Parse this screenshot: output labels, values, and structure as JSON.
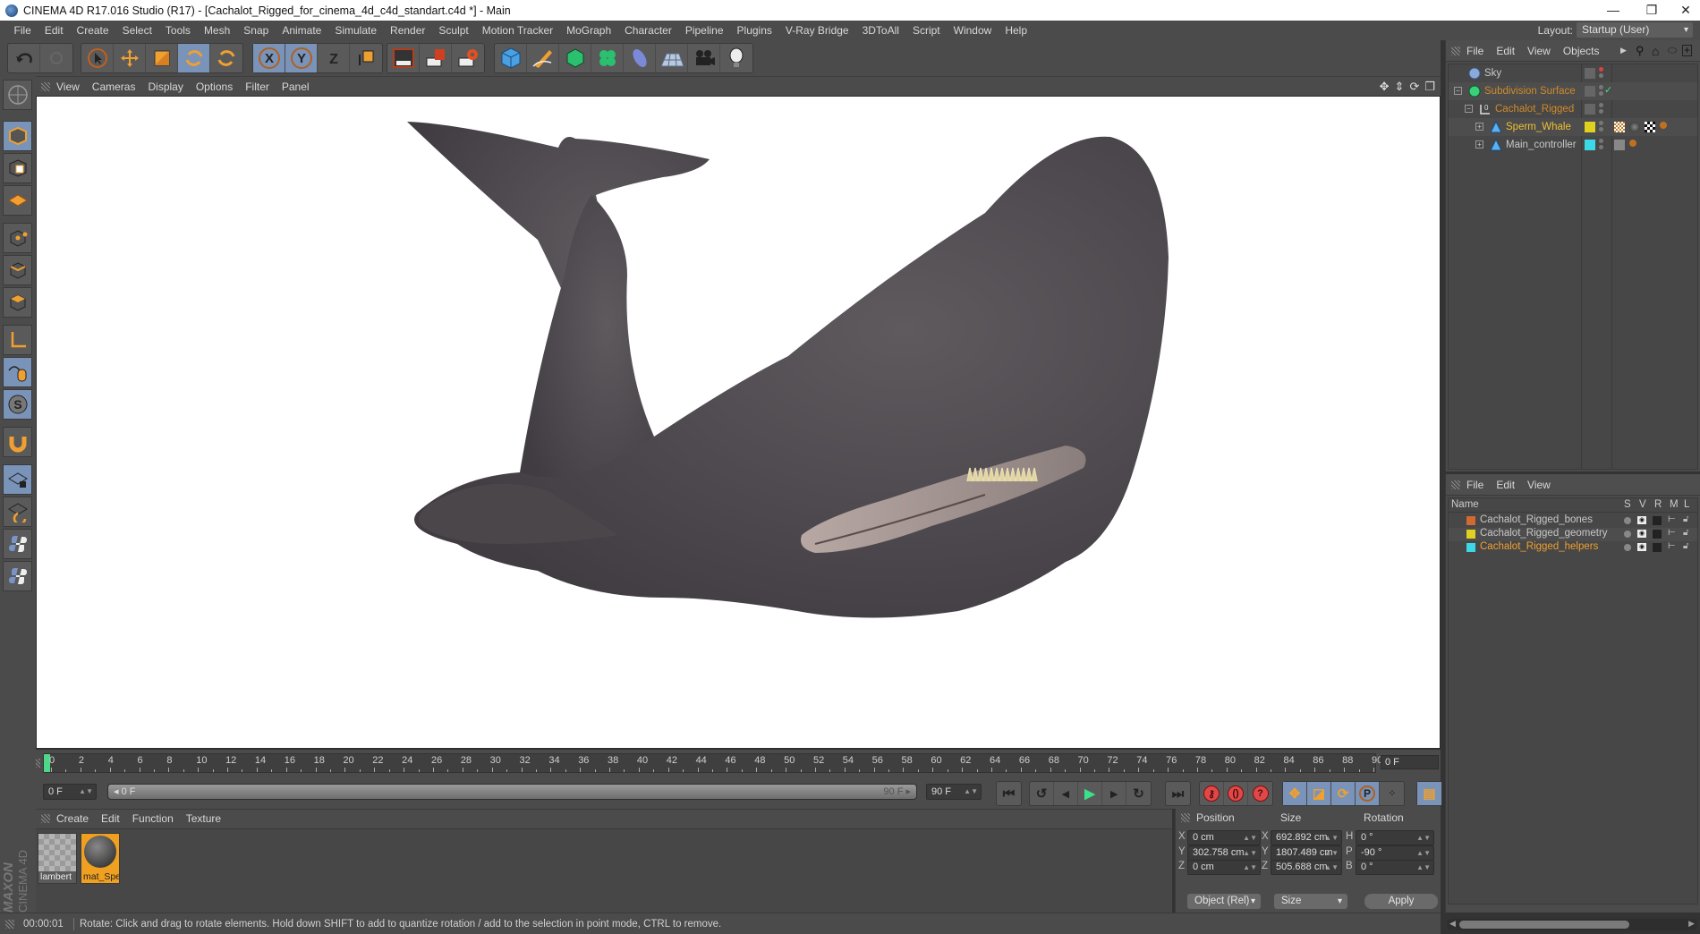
{
  "window": {
    "title": "CINEMA 4D R17.016 Studio (R17) - [Cachalot_Rigged_for_cinema_4d_c4d_standart.c4d *] - Main",
    "controls": [
      "minimize",
      "restore",
      "close"
    ]
  },
  "menubar": {
    "items": [
      "File",
      "Edit",
      "Create",
      "Select",
      "Tools",
      "Mesh",
      "Snap",
      "Animate",
      "Simulate",
      "Render",
      "Sculpt",
      "Motion Tracker",
      "MoGraph",
      "Character",
      "Pipeline",
      "Plugins",
      "V-Ray Bridge",
      "3DToAll",
      "Script",
      "Window",
      "Help"
    ],
    "layout_label": "Layout:",
    "layout_value": "Startup (User)"
  },
  "toolbar": {
    "groups": [
      [
        "undo-icon",
        "redo-icon"
      ],
      [
        "live-selection-icon",
        "move-icon",
        "scale-icon",
        "rotate-icon",
        "recent-tool-icon"
      ],
      [
        "x-axis-icon",
        "y-axis-icon",
        "z-axis-icon",
        "coordinate-system-icon"
      ],
      [
        "render-view-icon",
        "render-picture-viewer-icon",
        "render-settings-icon"
      ],
      [
        "cube-icon",
        "pen-icon",
        "subdivision-icon",
        "cloner-icon",
        "deformer-icon",
        "floor-icon",
        "camera-icon",
        "light-icon"
      ]
    ]
  },
  "left_tools": [
    "make-editable-icon",
    "model-mode-icon",
    "texture-mode-icon",
    "workplane-icon",
    "points-mode-icon",
    "edges-mode-icon",
    "polygons-mode-icon",
    "axis-mode-icon",
    "tweak-mode-icon",
    "solo-icon",
    "snap-icon",
    "lock-workplane-icon",
    "planar-workplane-icon",
    "python-icon",
    "python-icon-2"
  ],
  "viewport": {
    "menu": [
      "View",
      "Cameras",
      "Display",
      "Options",
      "Filter",
      "Panel"
    ],
    "nav_icons": [
      "pan-icon",
      "dolly-icon",
      "orbit-icon",
      "maximize-icon"
    ],
    "scene": "Sperm whale 3D model render"
  },
  "timeline": {
    "start": 0,
    "end": 90,
    "step": 2,
    "current_frame_field": "0 F",
    "min_field": "0 F",
    "range_start_label": "0 F",
    "range_end_label": "90 F",
    "max_field": "90 F"
  },
  "playback": {
    "buttons": [
      "go-to-start-icon",
      "previous-key-icon",
      "previous-frame-icon",
      "play-icon",
      "next-frame-icon",
      "next-key-icon",
      "go-to-end-icon"
    ],
    "record_buttons": [
      "record-key-icon",
      "autokey-icon",
      "keyframe-selection-icon"
    ],
    "key_buttons": [
      "key-position-icon",
      "key-scale-icon",
      "key-rotation-icon",
      "key-parameter-icon",
      "key-point-level-icon"
    ],
    "timeline_button": "timeline-icon"
  },
  "material_manager": {
    "menu": [
      "Create",
      "Edit",
      "Function",
      "Texture"
    ],
    "materials": [
      {
        "name": "lambert",
        "selected": false
      },
      {
        "name": "mat_Spe",
        "selected": true
      }
    ]
  },
  "brand": {
    "maxon": "MAXON",
    "cinema": "CINEMA 4D"
  },
  "coordinates": {
    "headers": [
      "Position",
      "Size",
      "Rotation"
    ],
    "rows": [
      {
        "pos_axis": "X",
        "pos": "0 cm",
        "size_axis": "X",
        "size": "692.892 cm",
        "rot_axis": "H",
        "rot": "0 °"
      },
      {
        "pos_axis": "Y",
        "pos": "302.758 cm",
        "size_axis": "Y",
        "size": "1807.489 cm",
        "rot_axis": "P",
        "rot": "-90 °"
      },
      {
        "pos_axis": "Z",
        "pos": "0 cm",
        "size_axis": "Z",
        "size": "505.688 cm",
        "rot_axis": "B",
        "rot": "0 °"
      }
    ],
    "mode_dropdown": "Object (Rel)",
    "size_dropdown": "Size",
    "apply_label": "Apply"
  },
  "status": {
    "time": "00:00:01",
    "message": "Rotate: Click and drag to rotate elements. Hold down SHIFT to add to quantize rotation / add to the selection in point mode, CTRL to remove."
  },
  "object_manager": {
    "menu": [
      "File",
      "Edit",
      "View",
      "Objects"
    ],
    "objects": [
      {
        "name": "Sky",
        "color": "#c8c8c8",
        "layer_color": null
      },
      {
        "name": "Subdivision Surface",
        "color": "#d08a2a",
        "layer_color": null,
        "checked": true
      },
      {
        "name": "Cachalot_Rigged",
        "color": "#d08a2a",
        "layer_color": null
      },
      {
        "name": "Sperm_Whale",
        "color": "#f0c030",
        "layer_color": "#e0d020"
      },
      {
        "name": "Main_controller",
        "color": "#c8c8c8",
        "layer_color": "#3dd8e8"
      }
    ]
  },
  "layer_manager": {
    "menu": [
      "File",
      "Edit",
      "View"
    ],
    "columns": [
      "Name",
      "S",
      "V",
      "R",
      "M",
      "L"
    ],
    "layers": [
      {
        "name": "Cachalot_Rigged_bones",
        "color": "#d06a30",
        "text_color": "#c8c8c8"
      },
      {
        "name": "Cachalot_Rigged_geometry",
        "color": "#e0d020",
        "text_color": "#c8c8c8"
      },
      {
        "name": "Cachalot_Rigged_helpers",
        "color": "#3dd8e8",
        "text_color": "#f0a030"
      }
    ]
  }
}
